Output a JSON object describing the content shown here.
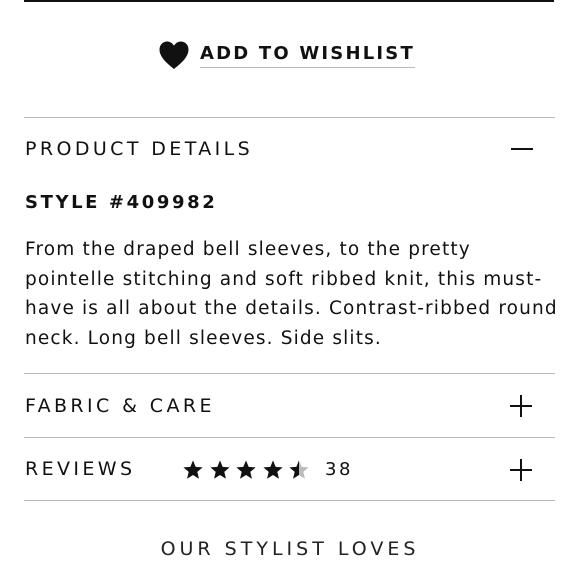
{
  "wishlist": {
    "label": "ADD TO WISHLIST",
    "icon": "heart-icon"
  },
  "product_details": {
    "title": "PRODUCT DETAILS",
    "state": "expanded",
    "toggle_icon": "minus-icon",
    "style_number": "STYLE #409982",
    "description": "From the draped bell sleeves, to the pretty pointelle stitching and soft ribbed knit, this must-have is all about the details. Contrast-ribbed round neck. Long bell sleeves. Side slits."
  },
  "fabric_care": {
    "title": "FABRIC & CARE",
    "state": "collapsed",
    "toggle_icon": "plus-icon"
  },
  "reviews": {
    "title": "REVIEWS",
    "rating": 4.5,
    "rating_max": 5,
    "count": "38",
    "state": "collapsed",
    "toggle_icon": "plus-icon"
  },
  "stylist": {
    "title": "OUR STYLIST LOVES"
  },
  "colors": {
    "text": "#111111",
    "divider": "#b8b8b8",
    "star_empty": "#bbbbbb"
  }
}
